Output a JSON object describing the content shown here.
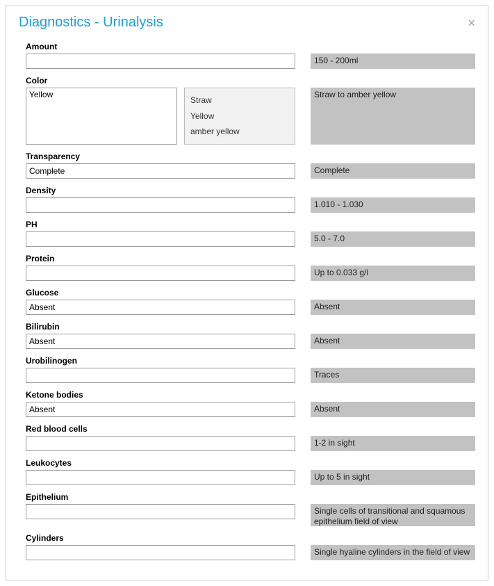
{
  "dialog": {
    "title": "Diagnostics - Urinalysis",
    "close_label": "×"
  },
  "fields": {
    "amount": {
      "label": "Amount",
      "value": "",
      "ref": "150 - 200ml"
    },
    "color": {
      "label": "Color",
      "value": "Yellow",
      "options": {
        "o1": "Straw",
        "o2": "Yellow",
        "o3": "amber yellow"
      },
      "ref": "Straw to amber yellow"
    },
    "transparency": {
      "label": "Transparency",
      "value": "Complete",
      "ref": "Complete"
    },
    "density": {
      "label": "Density",
      "value": "",
      "ref": "1.010 - 1.030"
    },
    "ph": {
      "label": "PH",
      "value": "",
      "ref": "5.0 - 7.0"
    },
    "protein": {
      "label": "Protein",
      "value": "",
      "ref": "Up to 0.033 g/l"
    },
    "glucose": {
      "label": "Glucose",
      "value": "Absent",
      "ref": "Absent"
    },
    "bilirubin": {
      "label": "Bilirubin",
      "value": "Absent",
      "ref": "Absent"
    },
    "urobilinogen": {
      "label": "Urobilinogen",
      "value": "",
      "ref": "Traces"
    },
    "ketone": {
      "label": "Ketone bodies",
      "value": "Absent",
      "ref": "Absent"
    },
    "rbc": {
      "label": "Red blood cells",
      "value": "",
      "ref": "1-2 in sight"
    },
    "leukocytes": {
      "label": "Leukocytes",
      "value": "",
      "ref": "Up to 5 in sight"
    },
    "epithelium": {
      "label": "Epithelium",
      "value": "",
      "ref": "Single cells of transitional and squamous epithelium field of view"
    },
    "cylinders": {
      "label": "Cylinders",
      "value": "",
      "ref": "Single hyaline cylinders in the field of view"
    }
  }
}
